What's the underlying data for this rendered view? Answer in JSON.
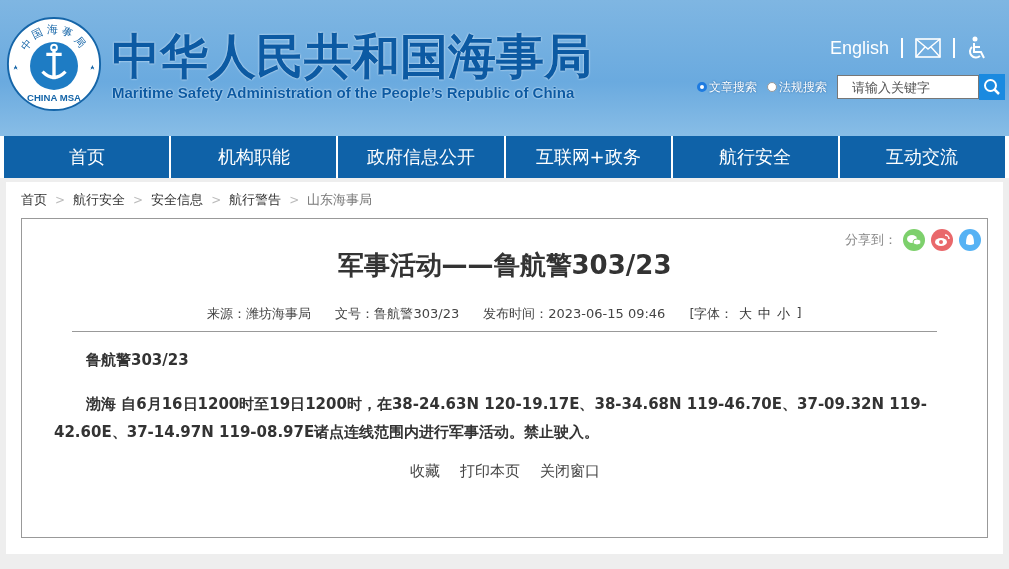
{
  "header": {
    "logo": {
      "ring_text": "中国海事局",
      "bottom_text": "CHINA MSA"
    },
    "title": "中华人民共和国海事局",
    "subtitle": "Maritime Safety Administration of the People’s Republic of China",
    "links": {
      "english": "English"
    },
    "search_types": [
      {
        "label": "文章搜索",
        "selected": true
      },
      {
        "label": "法规搜索",
        "selected": false
      }
    ],
    "search": {
      "placeholder": "请输入关键字"
    }
  },
  "nav": [
    "首页",
    "机构职能",
    "政府信息公开",
    "互联网+政务",
    "航行安全",
    "互动交流"
  ],
  "breadcrumb": [
    {
      "label": "首页"
    },
    {
      "separator": ">",
      "label": "航行安全"
    },
    {
      "separator": ">",
      "label": "安全信息"
    },
    {
      "separator": ">",
      "label": "航行警告"
    },
    {
      "separator": ">",
      "label": "山东海事局"
    }
  ],
  "article": {
    "share_label": "分享到：",
    "title": "军事活动——鲁航警303/23",
    "meta": {
      "source": "来源：潍坊海事局",
      "doc_no": "文号：鲁航警303/23",
      "published": "发布时间：2023-06-15 09:46",
      "font_label": "[字体：",
      "font_sizes": [
        "大",
        "中",
        "小"
      ],
      "font_close": "]"
    },
    "paragraphs": [
      "鲁航警303/23",
      "渤海 自6月16日1200时至19日1200时，在38-24.63N 120-19.17E、38-34.68N 119-46.70E、37-09.32N 119-42.60E、37-14.97N 119-08.97E诸点连线范围内进行军事活动。禁止驶入。"
    ],
    "actions": [
      "收藏",
      "打印本页",
      "关闭窗口"
    ]
  }
}
